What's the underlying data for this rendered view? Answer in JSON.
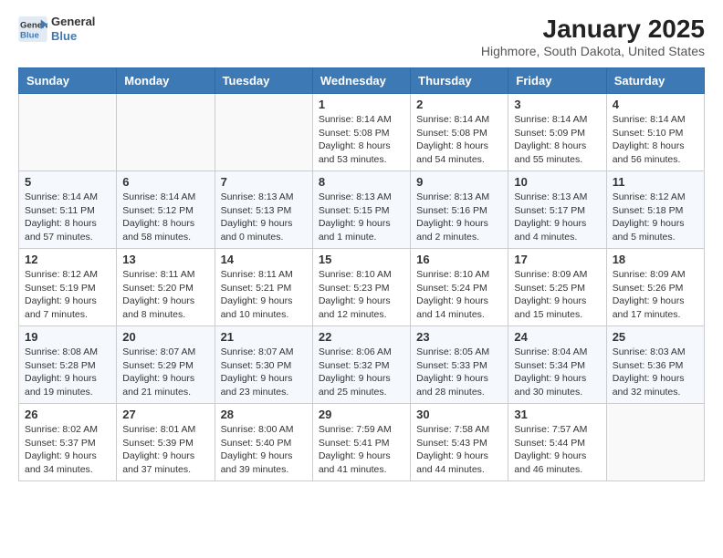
{
  "logo": {
    "line1": "General",
    "line2": "Blue"
  },
  "title": "January 2025",
  "location": "Highmore, South Dakota, United States",
  "headers": [
    "Sunday",
    "Monday",
    "Tuesday",
    "Wednesday",
    "Thursday",
    "Friday",
    "Saturday"
  ],
  "weeks": [
    [
      {
        "day": "",
        "content": ""
      },
      {
        "day": "",
        "content": ""
      },
      {
        "day": "",
        "content": ""
      },
      {
        "day": "1",
        "content": "Sunrise: 8:14 AM\nSunset: 5:08 PM\nDaylight: 8 hours\nand 53 minutes."
      },
      {
        "day": "2",
        "content": "Sunrise: 8:14 AM\nSunset: 5:08 PM\nDaylight: 8 hours\nand 54 minutes."
      },
      {
        "day": "3",
        "content": "Sunrise: 8:14 AM\nSunset: 5:09 PM\nDaylight: 8 hours\nand 55 minutes."
      },
      {
        "day": "4",
        "content": "Sunrise: 8:14 AM\nSunset: 5:10 PM\nDaylight: 8 hours\nand 56 minutes."
      }
    ],
    [
      {
        "day": "5",
        "content": "Sunrise: 8:14 AM\nSunset: 5:11 PM\nDaylight: 8 hours\nand 57 minutes."
      },
      {
        "day": "6",
        "content": "Sunrise: 8:14 AM\nSunset: 5:12 PM\nDaylight: 8 hours\nand 58 minutes."
      },
      {
        "day": "7",
        "content": "Sunrise: 8:13 AM\nSunset: 5:13 PM\nDaylight: 9 hours\nand 0 minutes."
      },
      {
        "day": "8",
        "content": "Sunrise: 8:13 AM\nSunset: 5:15 PM\nDaylight: 9 hours\nand 1 minute."
      },
      {
        "day": "9",
        "content": "Sunrise: 8:13 AM\nSunset: 5:16 PM\nDaylight: 9 hours\nand 2 minutes."
      },
      {
        "day": "10",
        "content": "Sunrise: 8:13 AM\nSunset: 5:17 PM\nDaylight: 9 hours\nand 4 minutes."
      },
      {
        "day": "11",
        "content": "Sunrise: 8:12 AM\nSunset: 5:18 PM\nDaylight: 9 hours\nand 5 minutes."
      }
    ],
    [
      {
        "day": "12",
        "content": "Sunrise: 8:12 AM\nSunset: 5:19 PM\nDaylight: 9 hours\nand 7 minutes."
      },
      {
        "day": "13",
        "content": "Sunrise: 8:11 AM\nSunset: 5:20 PM\nDaylight: 9 hours\nand 8 minutes."
      },
      {
        "day": "14",
        "content": "Sunrise: 8:11 AM\nSunset: 5:21 PM\nDaylight: 9 hours\nand 10 minutes."
      },
      {
        "day": "15",
        "content": "Sunrise: 8:10 AM\nSunset: 5:23 PM\nDaylight: 9 hours\nand 12 minutes."
      },
      {
        "day": "16",
        "content": "Sunrise: 8:10 AM\nSunset: 5:24 PM\nDaylight: 9 hours\nand 14 minutes."
      },
      {
        "day": "17",
        "content": "Sunrise: 8:09 AM\nSunset: 5:25 PM\nDaylight: 9 hours\nand 15 minutes."
      },
      {
        "day": "18",
        "content": "Sunrise: 8:09 AM\nSunset: 5:26 PM\nDaylight: 9 hours\nand 17 minutes."
      }
    ],
    [
      {
        "day": "19",
        "content": "Sunrise: 8:08 AM\nSunset: 5:28 PM\nDaylight: 9 hours\nand 19 minutes."
      },
      {
        "day": "20",
        "content": "Sunrise: 8:07 AM\nSunset: 5:29 PM\nDaylight: 9 hours\nand 21 minutes."
      },
      {
        "day": "21",
        "content": "Sunrise: 8:07 AM\nSunset: 5:30 PM\nDaylight: 9 hours\nand 23 minutes."
      },
      {
        "day": "22",
        "content": "Sunrise: 8:06 AM\nSunset: 5:32 PM\nDaylight: 9 hours\nand 25 minutes."
      },
      {
        "day": "23",
        "content": "Sunrise: 8:05 AM\nSunset: 5:33 PM\nDaylight: 9 hours\nand 28 minutes."
      },
      {
        "day": "24",
        "content": "Sunrise: 8:04 AM\nSunset: 5:34 PM\nDaylight: 9 hours\nand 30 minutes."
      },
      {
        "day": "25",
        "content": "Sunrise: 8:03 AM\nSunset: 5:36 PM\nDaylight: 9 hours\nand 32 minutes."
      }
    ],
    [
      {
        "day": "26",
        "content": "Sunrise: 8:02 AM\nSunset: 5:37 PM\nDaylight: 9 hours\nand 34 minutes."
      },
      {
        "day": "27",
        "content": "Sunrise: 8:01 AM\nSunset: 5:39 PM\nDaylight: 9 hours\nand 37 minutes."
      },
      {
        "day": "28",
        "content": "Sunrise: 8:00 AM\nSunset: 5:40 PM\nDaylight: 9 hours\nand 39 minutes."
      },
      {
        "day": "29",
        "content": "Sunrise: 7:59 AM\nSunset: 5:41 PM\nDaylight: 9 hours\nand 41 minutes."
      },
      {
        "day": "30",
        "content": "Sunrise: 7:58 AM\nSunset: 5:43 PM\nDaylight: 9 hours\nand 44 minutes."
      },
      {
        "day": "31",
        "content": "Sunrise: 7:57 AM\nSunset: 5:44 PM\nDaylight: 9 hours\nand 46 minutes."
      },
      {
        "day": "",
        "content": ""
      }
    ]
  ]
}
